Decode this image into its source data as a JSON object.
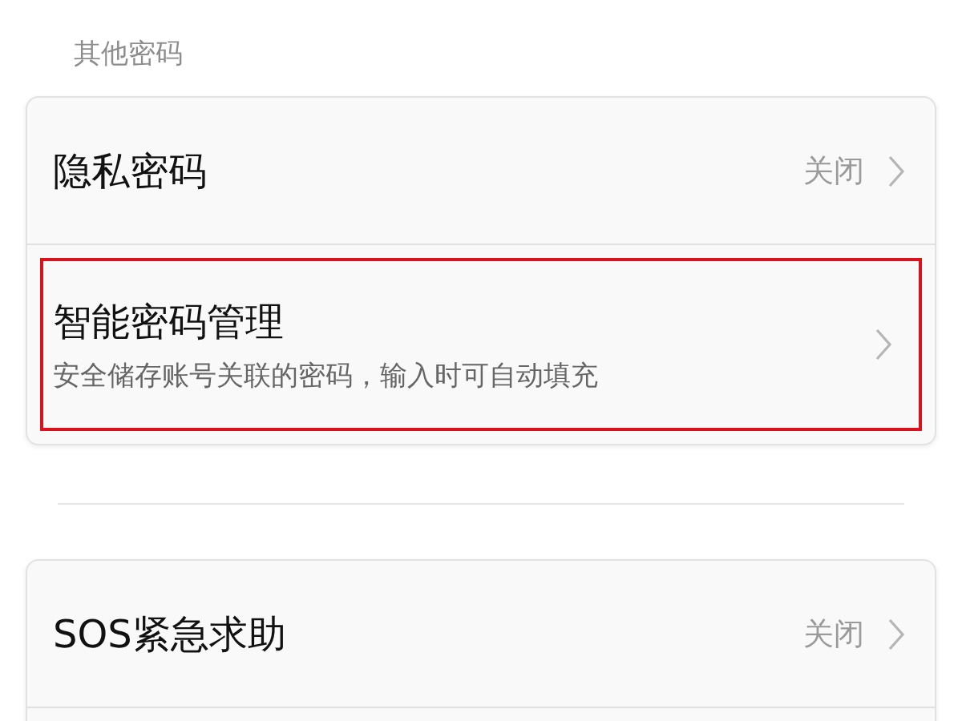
{
  "section_header": "其他密码",
  "groups": [
    {
      "items": [
        {
          "title": "隐私密码",
          "value": "关闭",
          "highlighted": false
        },
        {
          "title": "智能密码管理",
          "subtitle": "安全储存账号关联的密码，输入时可自动填充",
          "highlighted": true
        }
      ]
    },
    {
      "items": [
        {
          "title": "SOS紧急求助",
          "value": "关闭",
          "highlighted": false
        }
      ]
    }
  ]
}
